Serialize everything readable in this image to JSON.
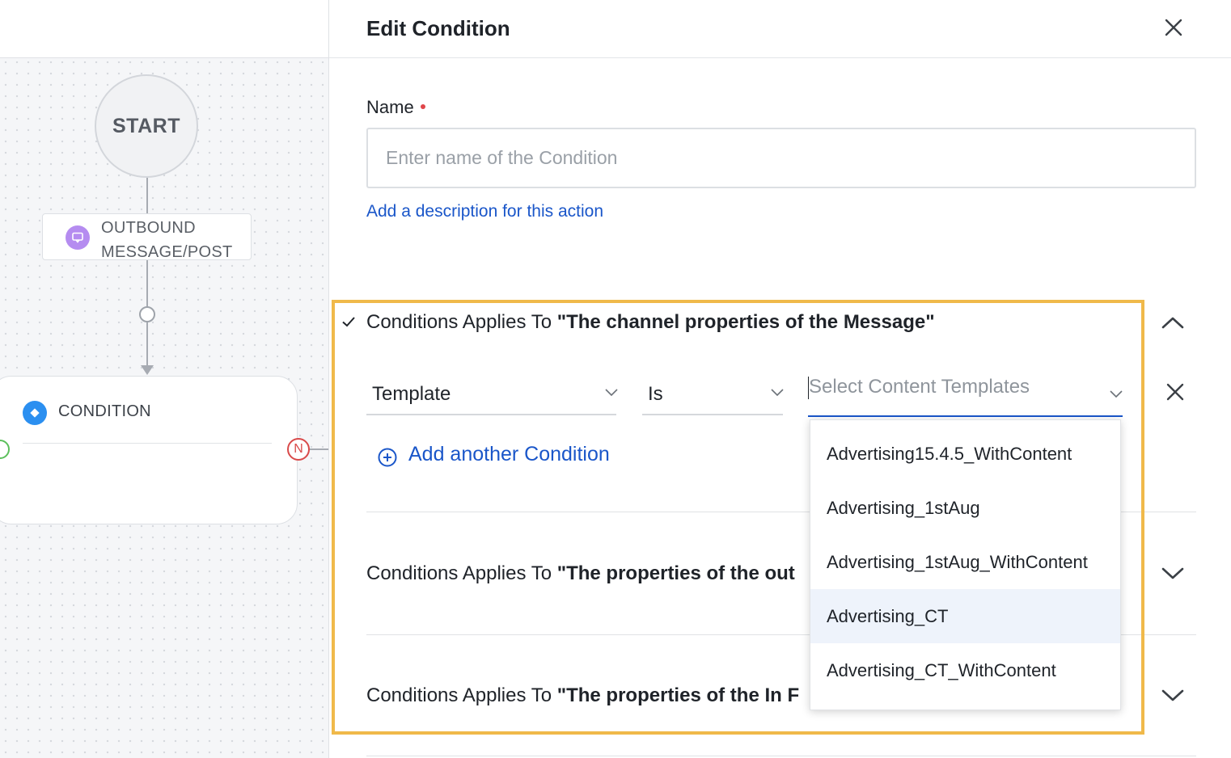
{
  "canvas": {
    "start_label": "START",
    "outbound_label_line1": "OUTBOUND",
    "outbound_label_line2": "MESSAGE/POST",
    "condition_label": "CONDITION",
    "no_port_label": "N"
  },
  "panel": {
    "title": "Edit Condition",
    "name_label": "Name",
    "name_placeholder": "Enter name of the Condition",
    "name_value": "",
    "description_link": "Add a description for this action"
  },
  "sections": [
    {
      "prefix": "Conditions Applies To ",
      "subject": "\"The channel properties of the Message\"",
      "expanded": true
    },
    {
      "prefix": "Conditions Applies To ",
      "subject": "\"The properties of the out",
      "expanded": false
    },
    {
      "prefix": "Conditions Applies To ",
      "subject": "\"The properties of the In F",
      "expanded": false
    }
  ],
  "condition_row": {
    "field": "Template",
    "operator": "Is",
    "value_placeholder": "Select Content Templates"
  },
  "add_condition_label": "Add another Condition",
  "dropdown": {
    "options": [
      "Advertising15.4.5_WithContent",
      "Advertising_1stAug",
      "Advertising_1stAug_WithContent",
      "Advertising_CT",
      "Advertising_CT_WithContent"
    ],
    "highlighted_index": 3
  },
  "colors": {
    "accent": "#1a56c9",
    "highlight_border": "#f0b94a",
    "required": "#e0464a"
  }
}
